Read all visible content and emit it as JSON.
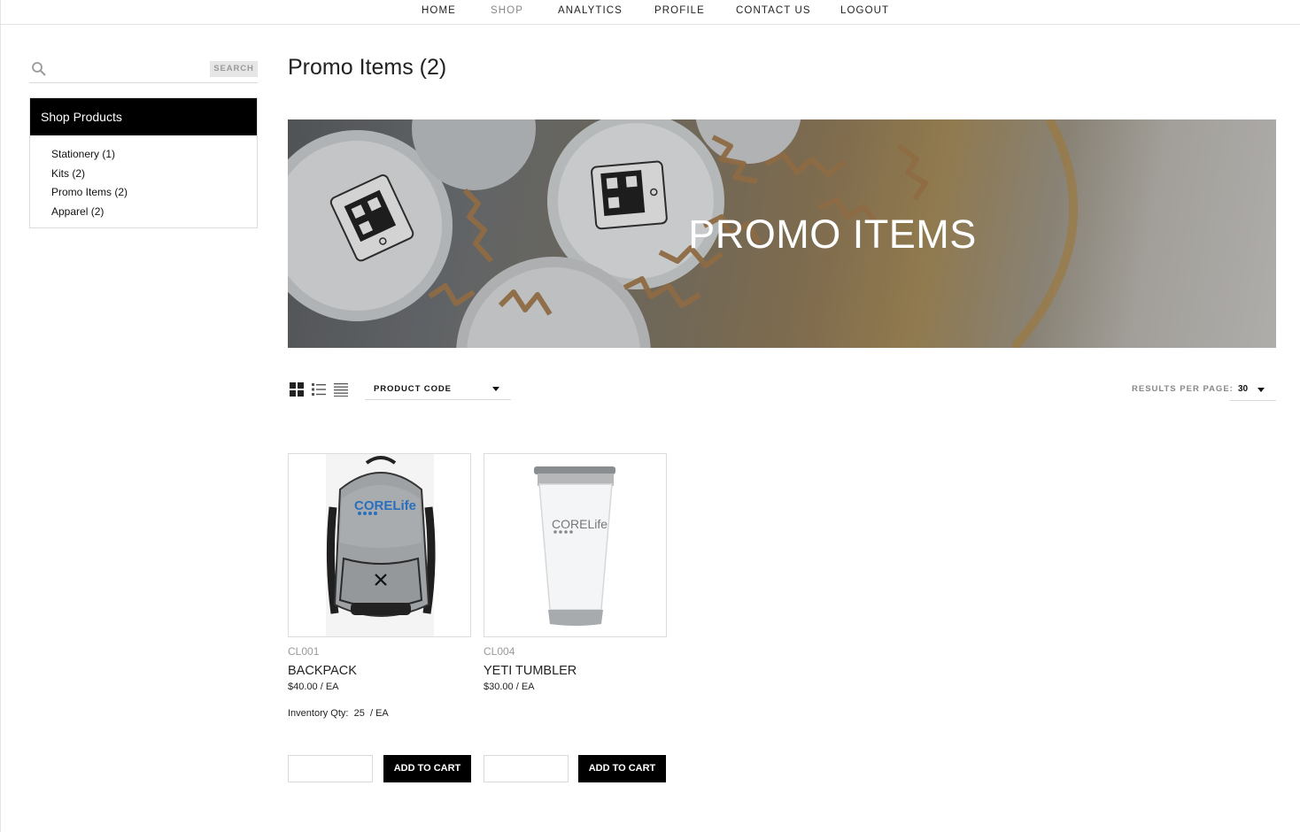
{
  "nav": {
    "items": [
      {
        "label": "HOME",
        "active": false
      },
      {
        "label": "SHOP",
        "active": true
      },
      {
        "label": "ANALYTICS",
        "active": false
      },
      {
        "label": "PROFILE",
        "active": false
      },
      {
        "label": "CONTACT US",
        "active": false
      },
      {
        "label": "LOGOUT",
        "active": false
      }
    ]
  },
  "sidebar": {
    "search": {
      "placeholder": "",
      "value": "",
      "button_label": "SEARCH",
      "icon": "search-icon"
    },
    "categories_title": "Shop Products",
    "categories": [
      {
        "label": "Stationery (1)"
      },
      {
        "label": "Kits (2)"
      },
      {
        "label": "Promo Items (2)"
      },
      {
        "label": "Apparel (2)"
      }
    ]
  },
  "main": {
    "title": "Promo Items (2)",
    "banner_text": "PROMO ITEMS",
    "toolbar": {
      "view_icons": [
        "grid-view-icon",
        "list-view-icon",
        "compact-list-icon"
      ],
      "sort_label": "PRODUCT CODE",
      "results_per_page_label": "RESULTS PER PAGE:",
      "results_per_page_value": "30"
    },
    "products": [
      {
        "code": "CL001",
        "name": "BACKPACK",
        "price": "$40.00 / EA",
        "inventory_label": "Inventory Qty:",
        "inventory_qty": "25",
        "inventory_unit": "/ EA",
        "add_label": "ADD TO CART",
        "image_logo_text": "CORELife"
      },
      {
        "code": "CL004",
        "name": "YETI TUMBLER",
        "price": "$30.00 / EA",
        "add_label": "ADD TO CART",
        "image_logo_text": "CORELife"
      }
    ]
  },
  "colors": {
    "accent": "#000000",
    "muted_text": "#999999",
    "border": "#dcdcdc",
    "brand_blue": "#2a6fbf"
  }
}
